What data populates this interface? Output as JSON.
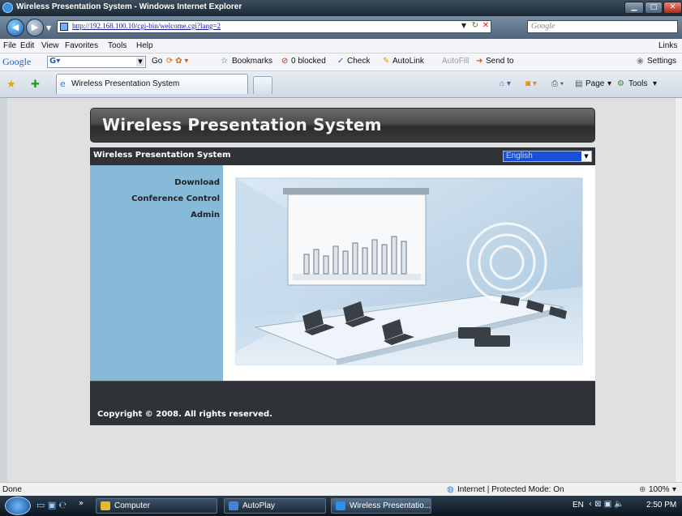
{
  "window": {
    "title": "Wireless Presentation System - Windows Internet Explorer"
  },
  "address": {
    "url": "http://192.168.100.10/cgi-bin/welcome.cgi?lang=2",
    "search_placeholder": "Google"
  },
  "menu": {
    "file": "File",
    "edit": "Edit",
    "view": "View",
    "favorites": "Favorites",
    "tools": "Tools",
    "help": "Help",
    "links": "Links"
  },
  "gtoolbar": {
    "logo": "Google",
    "go": "Go",
    "bookmarks": "Bookmarks",
    "blocked": "0 blocked",
    "check": "Check",
    "autolink": "AutoLink",
    "autofill": "AutoFill",
    "sendto": "Send to",
    "settings": "Settings"
  },
  "tabs": {
    "active": "Wireless Presentation System",
    "page": "Page",
    "tools": "Tools"
  },
  "page": {
    "banner": "Wireless Presentation System",
    "header_title": "Wireless Presentation System",
    "language": "English",
    "sidebar": [
      "Download",
      "Conference Control",
      "Admin"
    ],
    "copyright": "Copyright © 2008. All rights reserved."
  },
  "status": {
    "left": "Done",
    "zone": "Internet | Protected Mode: On",
    "zoom": "100%"
  },
  "taskbar": {
    "items": [
      "Computer",
      "AutoPlay",
      "Wireless Presentatio..."
    ],
    "lang": "EN",
    "time": "2:50 PM"
  }
}
